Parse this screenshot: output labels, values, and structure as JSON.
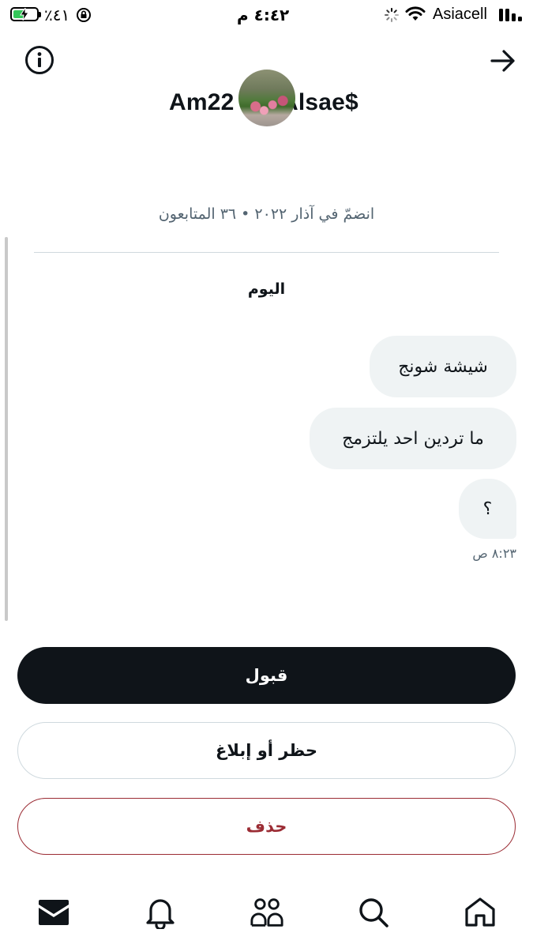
{
  "status_bar": {
    "carrier": "Asiacell",
    "time": "٤:٤٢ م",
    "battery_percent": "٪٤١"
  },
  "header": {
    "username": "Am22 Alsae$",
    "username_left": "Am22",
    "username_right": "Alsae$",
    "joined_info": "انضمّ في آذار ٢٠٢٢ • ٣٦ المتابعون"
  },
  "conversation": {
    "date_label": "اليوم",
    "messages": [
      {
        "text": "شيشة شونج"
      },
      {
        "text": "ما تردين احد يلتزمج"
      },
      {
        "text": "؟"
      }
    ],
    "last_time": "٨:٢٣ ص"
  },
  "actions": {
    "accept_label": "قبول",
    "block_report_label": "حظر أو إبلاغ",
    "delete_label": "حذف"
  },
  "bottom_nav": {
    "items": [
      {
        "icon": "mail-icon"
      },
      {
        "icon": "bell-icon"
      },
      {
        "icon": "people-icon"
      },
      {
        "icon": "search-icon"
      },
      {
        "icon": "home-icon"
      }
    ]
  },
  "colors": {
    "accept_bg": "#0f1419",
    "delete_text": "#9b2c34",
    "bubble_bg": "#eff3f4"
  }
}
